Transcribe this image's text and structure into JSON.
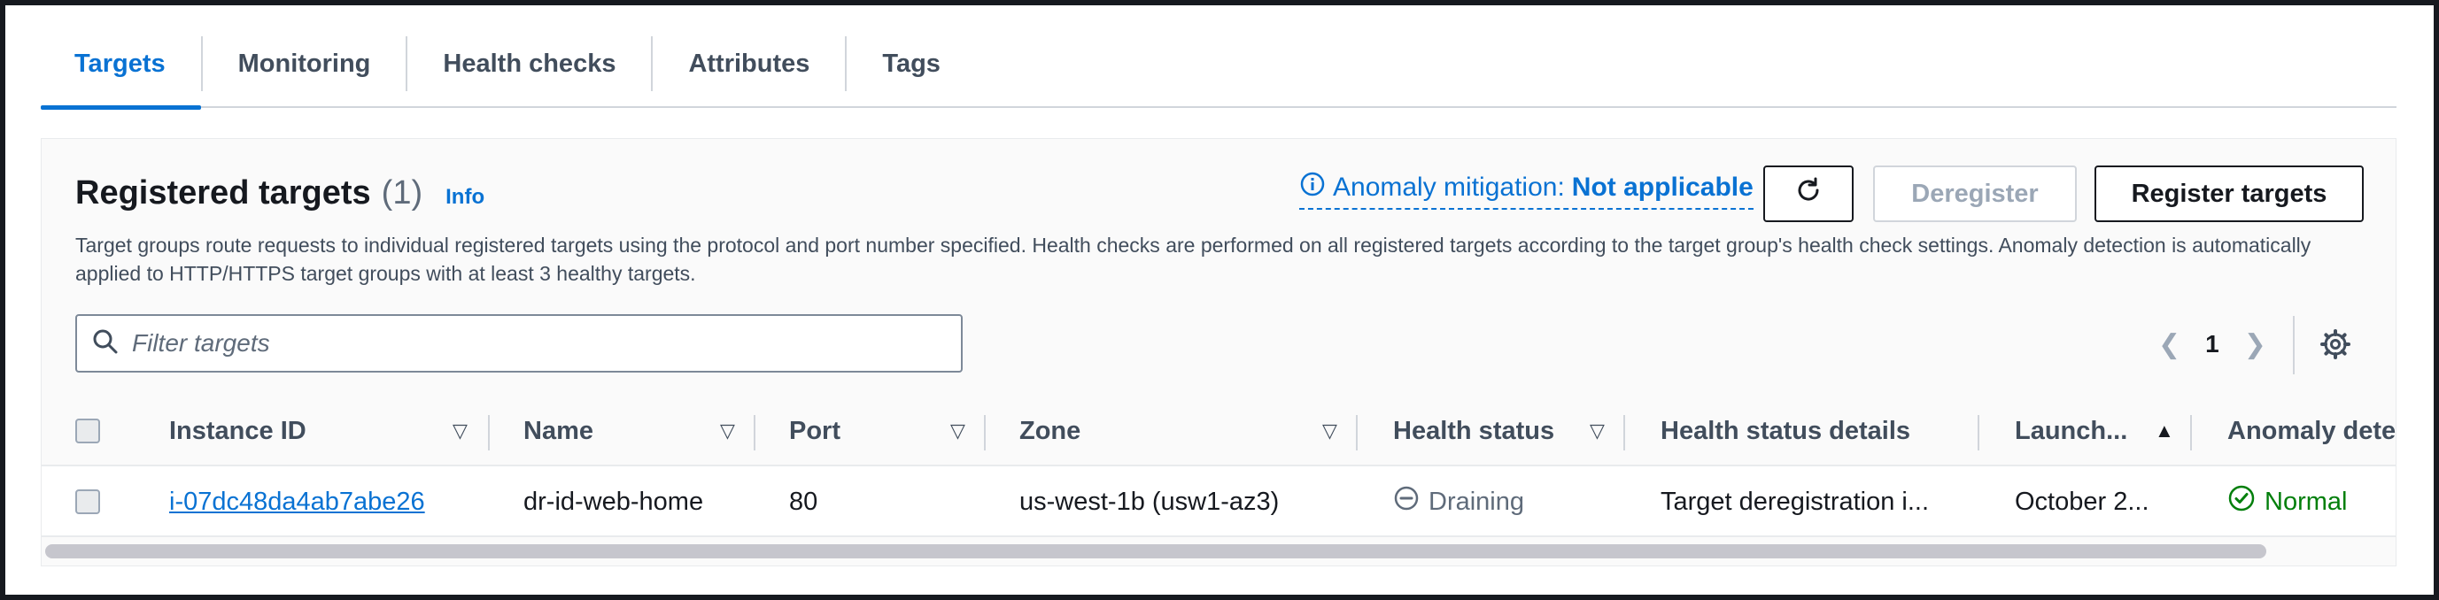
{
  "tabs": [
    {
      "label": "Targets",
      "active": true
    },
    {
      "label": "Monitoring"
    },
    {
      "label": "Health checks"
    },
    {
      "label": "Attributes"
    },
    {
      "label": "Tags"
    }
  ],
  "panel": {
    "title": "Registered targets",
    "count": "(1)",
    "info": "Info",
    "anomaly_label": "Anomaly mitigation:",
    "anomaly_value": "Not applicable",
    "refresh_icon": "refresh-icon",
    "deregister_label": "Deregister",
    "register_label": "Register targets",
    "description": "Target groups route requests to individual registered targets using the protocol and port number specified. Health checks are performed on all registered targets according to the target group's health check settings. Anomaly detection is automatically applied to HTTP/HTTPS target groups with at least 3 healthy targets."
  },
  "filter": {
    "placeholder": "Filter targets"
  },
  "pagination": {
    "page": "1"
  },
  "table": {
    "headers": {
      "instance_id": "Instance ID",
      "name": "Name",
      "port": "Port",
      "zone": "Zone",
      "health_status": "Health status",
      "health_details": "Health status details",
      "launch": "Launch...",
      "anomaly": "Anomaly detec"
    },
    "rows": [
      {
        "instance_id": "i-07dc48da4ab7abe26",
        "name": "dr-id-web-home",
        "port": "80",
        "zone": "us-west-1b (usw1-az3)",
        "health_status": "Draining",
        "health_details": "Target deregistration i...",
        "launch": "October 2...",
        "anomaly": "Normal"
      }
    ]
  },
  "colors": {
    "accent": "#0972d3",
    "success": "#037f0c",
    "muted": "#5f6b7a"
  }
}
